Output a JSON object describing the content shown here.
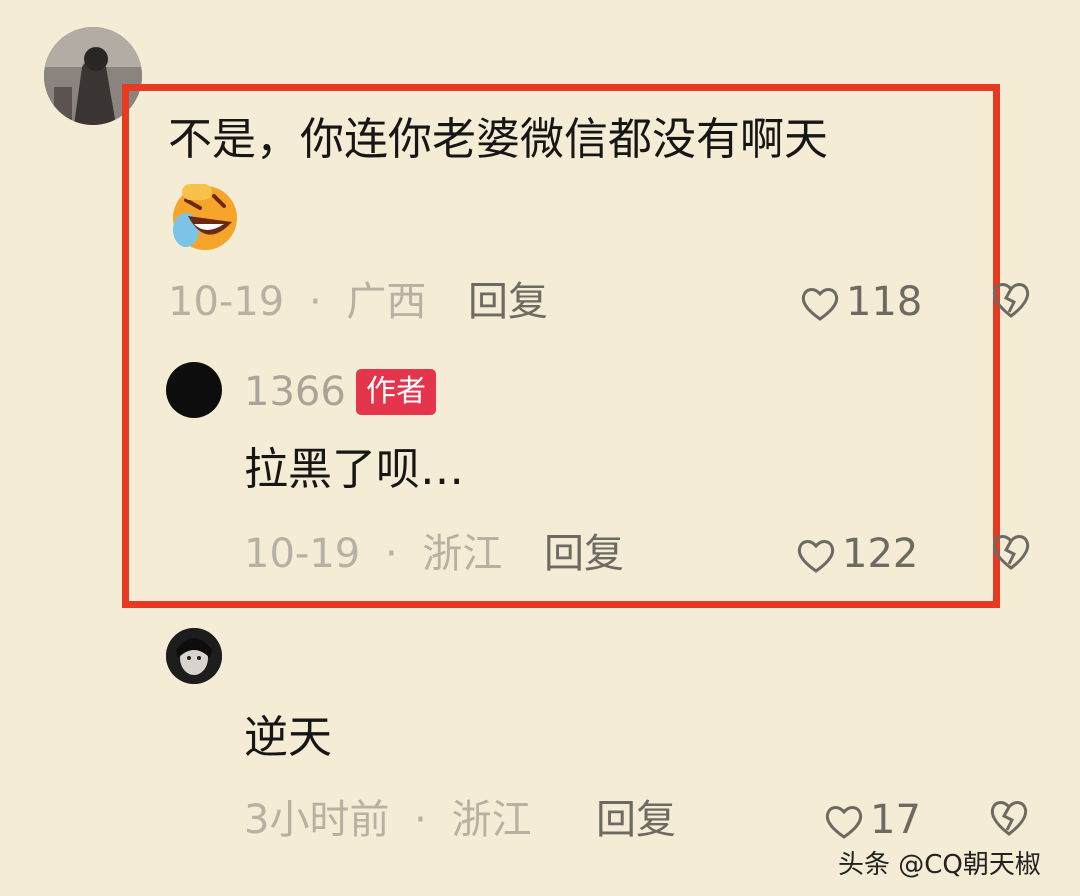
{
  "comments": [
    {
      "text": "不是，你连你老婆微信都没有啊天",
      "date": "10-19",
      "location": "广西",
      "reply_label": "回复",
      "likes": "118",
      "emoji_icon": "laughing-tears-emoji-icon"
    },
    {
      "username": "1366",
      "badge": "作者",
      "text": "拉黑了呗…",
      "date": "10-19",
      "location": "浙江",
      "reply_label": "回复",
      "likes": "122"
    },
    {
      "username": "",
      "text": "逆天",
      "date": "3小时前",
      "location": "浙江",
      "reply_label": "回复",
      "likes": "17"
    }
  ],
  "separator": "·",
  "watermark": "头条 @CQ朝天椒",
  "colors": {
    "background": "#f4ecd5",
    "highlight_border": "#e63a22",
    "author_badge": "#e5354c",
    "meta_text": "#b7b1a3",
    "action_text": "#6d6a64"
  }
}
